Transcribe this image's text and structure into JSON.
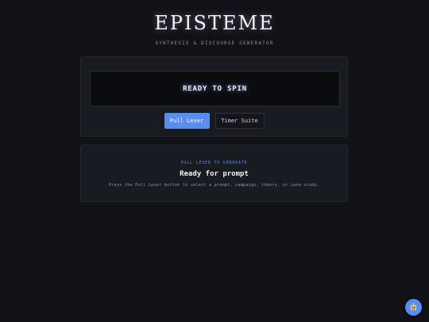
{
  "header": {
    "brand": "EPISTEME",
    "tagline": "SYNTHESIS & DISCOURSE GENERATOR"
  },
  "machine": {
    "display_text": "READY TO SPIN",
    "pull_button_label": "Pull Lever",
    "timer_button_label": "Timer Suite"
  },
  "result": {
    "kicker": "PULL LEVER TO GENERATE",
    "title": "Ready for prompt",
    "description": "Press the Pull Lever button to select a prompt, campaign, theory, or case study."
  },
  "assistant": {
    "icon": "robot-icon"
  },
  "colors": {
    "background": "#111217",
    "card": "#191b22",
    "accent": "#5b8cf0"
  }
}
